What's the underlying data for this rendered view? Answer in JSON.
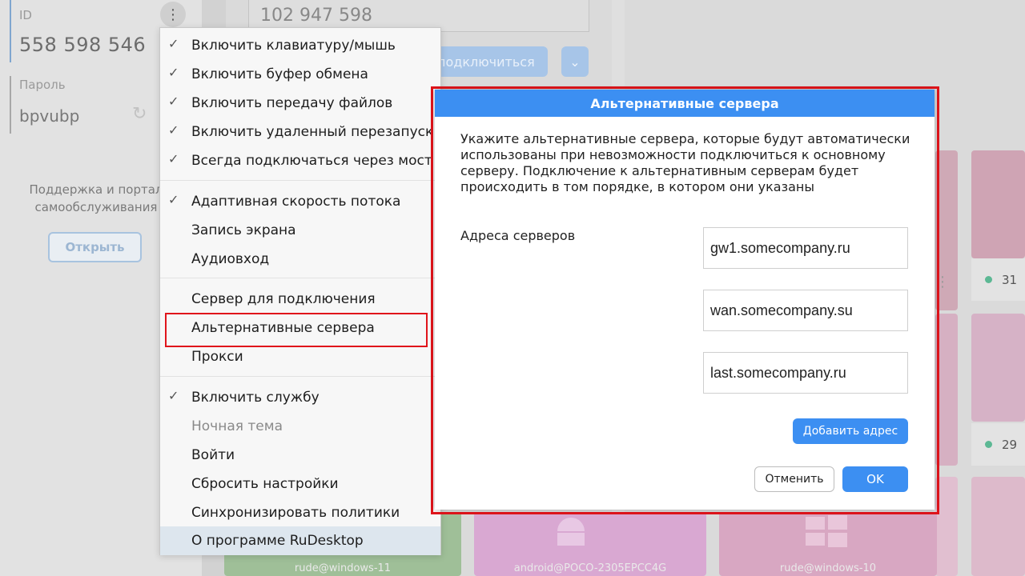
{
  "left_panel": {
    "id_label": "ID",
    "id_value": "558 598 546",
    "password_label": "Пароль",
    "password_value": "bpvubp",
    "support_text": "Поддержка и портал самообслуживания",
    "open_button": "Открыть"
  },
  "remote": {
    "id_value": "102 947 598",
    "connect_button": "подключиться"
  },
  "tiles": [
    {
      "label": "rude@windows-11",
      "count": ""
    },
    {
      "label": "android@POCO-2305EPCC4G",
      "count": ""
    },
    {
      "label": "rude@windows-10",
      "count": ""
    },
    {
      "label": "",
      "count": "31"
    },
    {
      "label": "",
      "count": "29"
    }
  ],
  "menu": {
    "items": [
      {
        "label": "Включить клавиатуру/мышь",
        "checked": true
      },
      {
        "label": "Включить буфер обмена",
        "checked": true
      },
      {
        "label": "Включить передачу файлов",
        "checked": true
      },
      {
        "label": "Включить удаленный перезапуск",
        "checked": true
      },
      {
        "label": "Всегда подключаться через мост",
        "checked": true
      },
      {
        "label": "Адаптивная скорость потока",
        "checked": true
      },
      {
        "label": "Запись экрана",
        "checked": false
      },
      {
        "label": "Аудиовход",
        "checked": false
      },
      {
        "label": "Сервер для подключения",
        "checked": false
      },
      {
        "label": "Альтернативные сервера",
        "checked": false
      },
      {
        "label": "Прокси",
        "checked": false
      },
      {
        "label": "Включить службу",
        "checked": true
      },
      {
        "label": "Ночная тема",
        "checked": false,
        "disabled": true
      },
      {
        "label": "Войти",
        "checked": false
      },
      {
        "label": "Сбросить настройки",
        "checked": false
      },
      {
        "label": "Синхронизировать политики",
        "checked": false
      },
      {
        "label": "О программе RuDesktop",
        "checked": false
      }
    ]
  },
  "dialog": {
    "title": "Альтернативные сервера",
    "description": "Укажите альтернативные сервера, которые будут автоматически использованы при невозможности подключиться к основному серверу. Подключение к альтернативным серверам будет происходить в том порядке, в котором они указаны",
    "servers_label": "Адреса серверов",
    "servers": [
      "gw1.somecompany.ru",
      "wan.somecompany.su",
      "last.somecompany.ru"
    ],
    "add_button": "Добавить адрес",
    "cancel_button": "Отменить",
    "ok_button": "OK"
  },
  "colors": {
    "accent": "#3c8ff2",
    "highlight": "#e0141b"
  }
}
